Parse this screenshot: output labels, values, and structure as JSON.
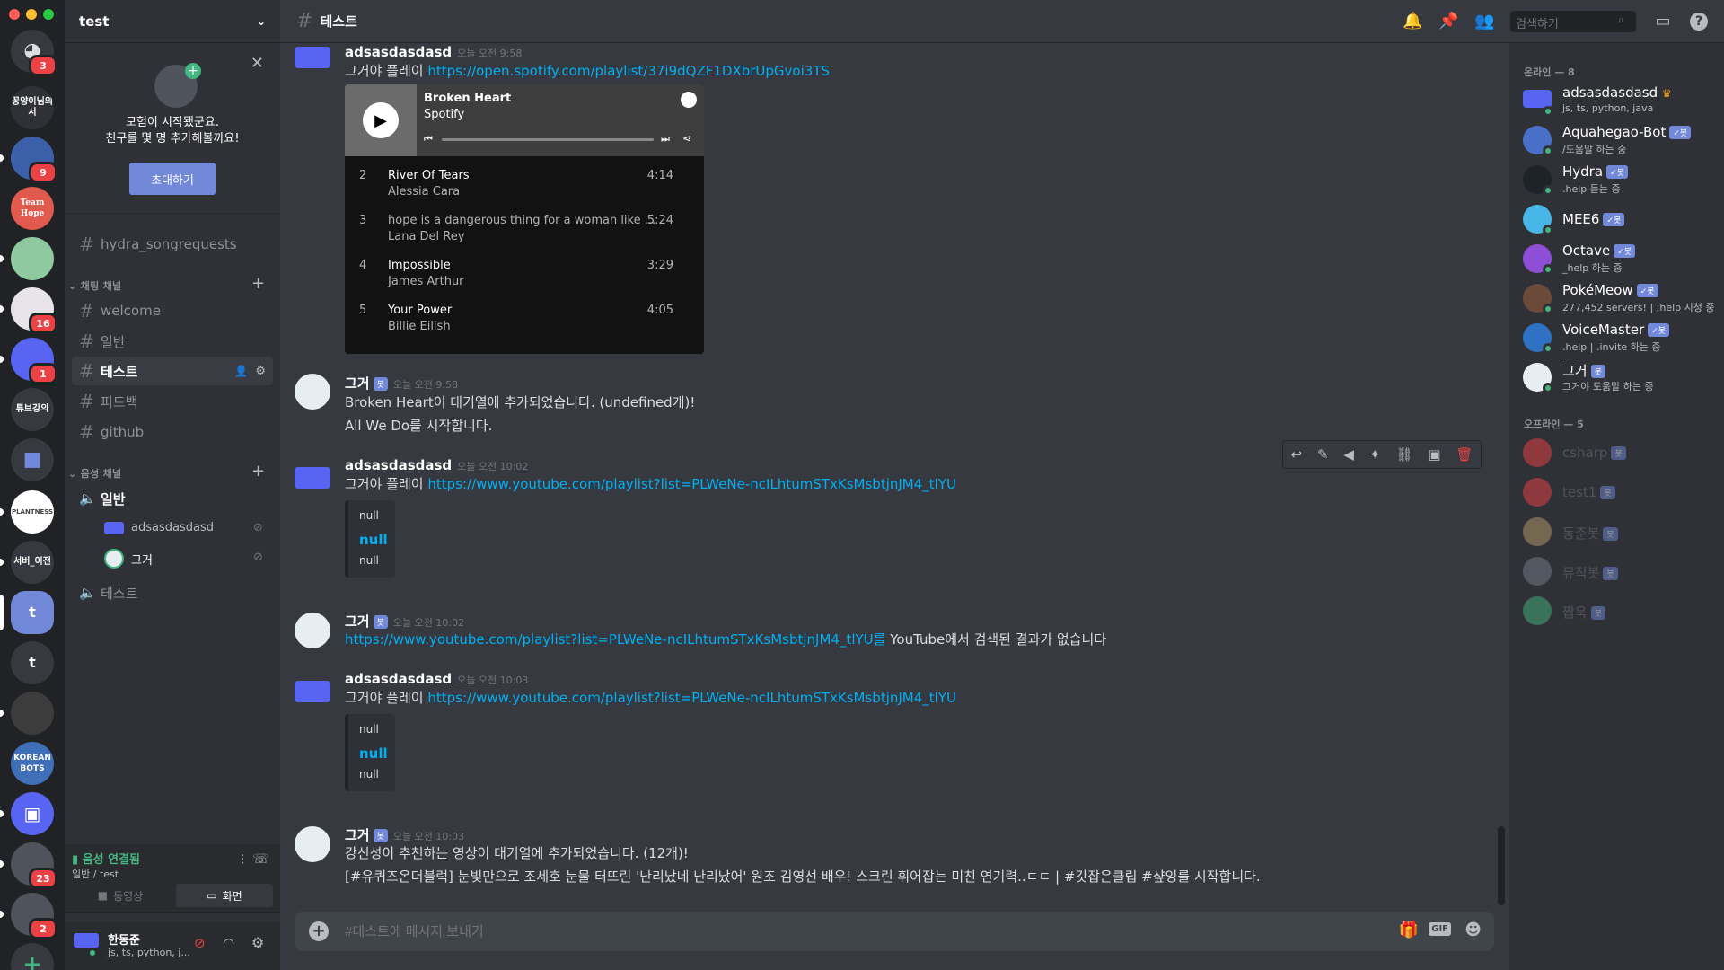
{
  "server": {
    "name": "test"
  },
  "rail": {
    "servers": [
      {
        "label": "",
        "badge": "3"
      },
      {
        "label": "꽁양이님의서",
        "badge": ""
      },
      {
        "label": "",
        "badge": "9"
      },
      {
        "label": "Team Hope",
        "badge": ""
      },
      {
        "label": "",
        "badge": ""
      },
      {
        "label": "",
        "badge": "16"
      },
      {
        "label": "",
        "badge": "1"
      },
      {
        "label": "튜브강의",
        "badge": ""
      },
      {
        "label": "",
        "badge": ""
      },
      {
        "label": "PLANTNESS",
        "badge": ""
      },
      {
        "label": "서버_이전",
        "badge": ""
      },
      {
        "label": "t",
        "badge": ""
      },
      {
        "label": "t",
        "badge": ""
      },
      {
        "label": "",
        "badge": ""
      },
      {
        "label": "KOREAN BOTS",
        "badge": ""
      },
      {
        "label": "",
        "badge": ""
      },
      {
        "label": "",
        "badge": "23"
      },
      {
        "label": "",
        "badge": "2"
      }
    ]
  },
  "invite": {
    "text1": "모험이 시작됐군요.",
    "text2": "친구를 몇 명 추가해볼까요!",
    "button": "초대하기"
  },
  "channels": {
    "top": "hydra_songrequests",
    "text_category": "채팅 채널",
    "text": [
      "welcome",
      "일반",
      "테스트",
      "피드백",
      "github"
    ],
    "voice_category": "음성 채널",
    "voice": [
      "일반",
      "테스트"
    ],
    "voice_users": [
      "adsasdasdasd",
      "그거"
    ]
  },
  "voice_panel": {
    "status": "음성 연결됨",
    "location": "일반 / test",
    "video": "동영상",
    "screen": "화면"
  },
  "user_panel": {
    "name": "한동준",
    "status": "js, ts, python, j..."
  },
  "header": {
    "channel": "테스트",
    "search_placeholder": "검색하기"
  },
  "messages": [
    {
      "author": "adsasdasdasd",
      "time": "오늘 오전 9:58",
      "text": "그거야 플레이",
      "link": "https://open.spotify.com/playlist/37i9dQZF1DXbrUpGvoi3TS"
    },
    {
      "author": "그거",
      "bot": "봇",
      "time": "오늘 오전 9:58",
      "text1": "Broken Heart이 대기열에 추가되었습니다. (undefined개)!",
      "text2": "All We Do를 시작합니다."
    },
    {
      "author": "adsasdasdasd",
      "time": "오늘 오전 10:02",
      "text": "그거야 플레이",
      "link": "https://www.youtube.com/playlist?list=PLWeNe-ncILhtumSTxKsMsbtjnJM4_tlYU"
    },
    {
      "author": "그거",
      "bot": "봇",
      "time": "오늘 오전 10:02",
      "link": "https://www.youtube.com/playlist?list=PLWeNe-ncILhtumSTxKsMsbtjnJM4_tlYU를",
      "text": "YouTube에서 검색된 결과가 없습니다"
    },
    {
      "author": "adsasdasdasd",
      "time": "오늘 오전 10:03",
      "text": "그거야 플레이",
      "link": "https://www.youtube.com/playlist?list=PLWeNe-ncILhtumSTxKsMsbtjnJM4_tlYU"
    },
    {
      "author": "그거",
      "bot": "봇",
      "time": "오늘 오전 10:03",
      "text1": "강신성이 추천하는 영상이 대기열에 추가되었습니다. (12개)!",
      "text2": "[#유퀴즈온더블럭] 눈빛만으로 조세호 눈물 터뜨린 '난리났네 난리났어' 원조 김영선 배우! 스크린 휘어잡는 미친 연기력..ㄷㄷ | #갓잡은클립 #샾잉를 시작합니다."
    }
  ],
  "null_embed": [
    "null",
    "null",
    "null"
  ],
  "spotify": {
    "title": "Broken Heart",
    "subtitle": "Spotify",
    "tracks": [
      {
        "n": "2",
        "title": "River Of Tears",
        "artist": "Alessia Cara",
        "dur": "4:14"
      },
      {
        "n": "3",
        "title": "hope is a dangerous thing for a woman like ...",
        "artist": "Lana Del Rey",
        "dur": "5:24"
      },
      {
        "n": "4",
        "title": "Impossible",
        "artist": "James Arthur",
        "dur": "3:29"
      },
      {
        "n": "5",
        "title": "Your Power",
        "artist": "Billie Eilish",
        "dur": "4:05"
      }
    ]
  },
  "composer": {
    "placeholder": "#테스트에 메시지 보내기"
  },
  "members": {
    "online_label": "온라인 — 8",
    "online": [
      {
        "name": "adsasdasdasd",
        "status": "js, ts, python, java",
        "tag": ""
      },
      {
        "name": "Aquahegao-Bot",
        "status": "/도움말 하는 중",
        "tag": "✓봇"
      },
      {
        "name": "Hydra",
        "status": ".help 듣는 중",
        "tag": "✓봇"
      },
      {
        "name": "MEE6",
        "status": "",
        "tag": "✓봇"
      },
      {
        "name": "Octave",
        "status": "_help 하는 중",
        "tag": "✓봇"
      },
      {
        "name": "PokéMeow",
        "status": "277,452 servers! | ;help 시청 중",
        "tag": "✓봇"
      },
      {
        "name": "VoiceMaster",
        "status": ".help | .invite 하는 중",
        "tag": "✓봇"
      },
      {
        "name": "그거",
        "status": "그거야 도움말 하는 중",
        "tag": "봇"
      }
    ],
    "offline_label": "오프라인 — 5",
    "offline": [
      {
        "name": "csharp",
        "tag": "봇"
      },
      {
        "name": "test1",
        "tag": "봇"
      },
      {
        "name": "동준봇",
        "tag": "봇"
      },
      {
        "name": "뮤직봇",
        "tag": "봇"
      },
      {
        "name": "짭욱",
        "tag": "봇"
      }
    ]
  },
  "colors": {
    "accent": "#7289da",
    "link": "#00b0f4",
    "online": "#43b581",
    "danger": "#ed4245"
  }
}
